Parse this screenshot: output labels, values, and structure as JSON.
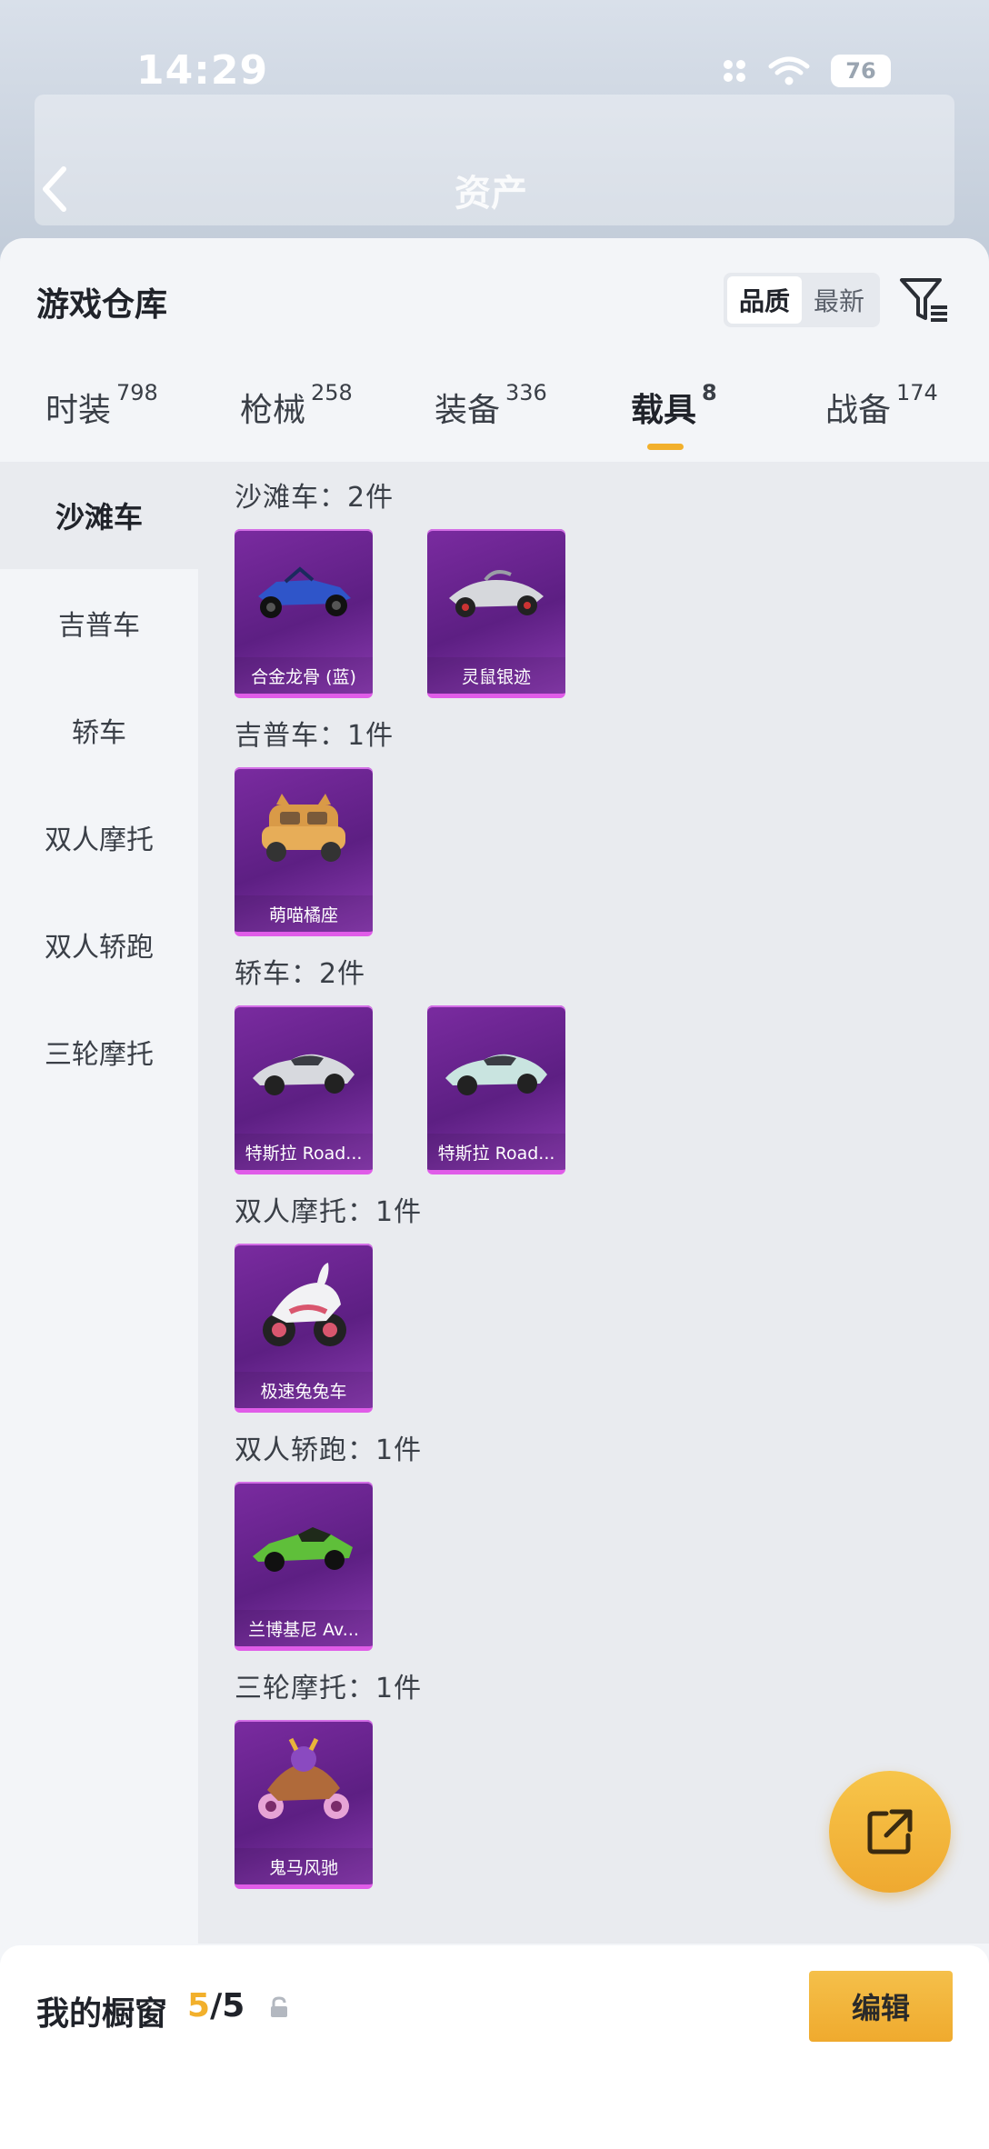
{
  "status_bar": {
    "time": "14:29",
    "battery": "76"
  },
  "background": {
    "title": "资产"
  },
  "header": {
    "title": "游戏仓库",
    "sort": [
      {
        "label": "品质",
        "active": true
      },
      {
        "label": "最新",
        "active": false
      }
    ]
  },
  "tabs": [
    {
      "label": "时装",
      "count": "798"
    },
    {
      "label": "枪械",
      "count": "258"
    },
    {
      "label": "装备",
      "count": "336"
    },
    {
      "label": "载具",
      "count": "8",
      "active": true
    },
    {
      "label": "战备",
      "count": "174"
    }
  ],
  "categories": [
    "沙滩车",
    "吉普车",
    "轿车",
    "双人摩托",
    "双人轿跑",
    "三轮摩托"
  ],
  "active_category": "沙滩车",
  "sections": [
    {
      "label": "沙滩车：2件",
      "items": [
        {
          "name": "合金龙骨 (蓝)",
          "icon": "blue-buggy-icon"
        },
        {
          "name": "灵鼠银迹",
          "icon": "silver-kart-icon"
        }
      ]
    },
    {
      "label": "吉普车：1件",
      "items": [
        {
          "name": "萌喵橘座",
          "icon": "cat-car-icon"
        }
      ]
    },
    {
      "label": "轿车：2件",
      "items": [
        {
          "name": "特斯拉 Road...",
          "icon": "tesla-roadster-icon"
        },
        {
          "name": "特斯拉 Road...",
          "icon": "tesla-roadster-icon"
        }
      ]
    },
    {
      "label": "双人摩托：1件",
      "items": [
        {
          "name": "极速兔兔车",
          "icon": "bunny-motorcycle-icon"
        }
      ]
    },
    {
      "label": "双人轿跑：1件",
      "items": [
        {
          "name": "兰博基尼 Av...",
          "icon": "lamborghini-icon"
        }
      ]
    },
    {
      "label": "三轮摩托：1件",
      "items": [
        {
          "name": "鬼马风驰",
          "icon": "ghost-trike-icon"
        }
      ]
    }
  ],
  "footer": {
    "title": "我的橱窗",
    "current": "5",
    "separator": "/",
    "total": "5",
    "edit_label": "编辑"
  },
  "colors": {
    "accent": "#f2b02c",
    "card_purple": "#6a2590",
    "card_border": "#e05ce8"
  }
}
